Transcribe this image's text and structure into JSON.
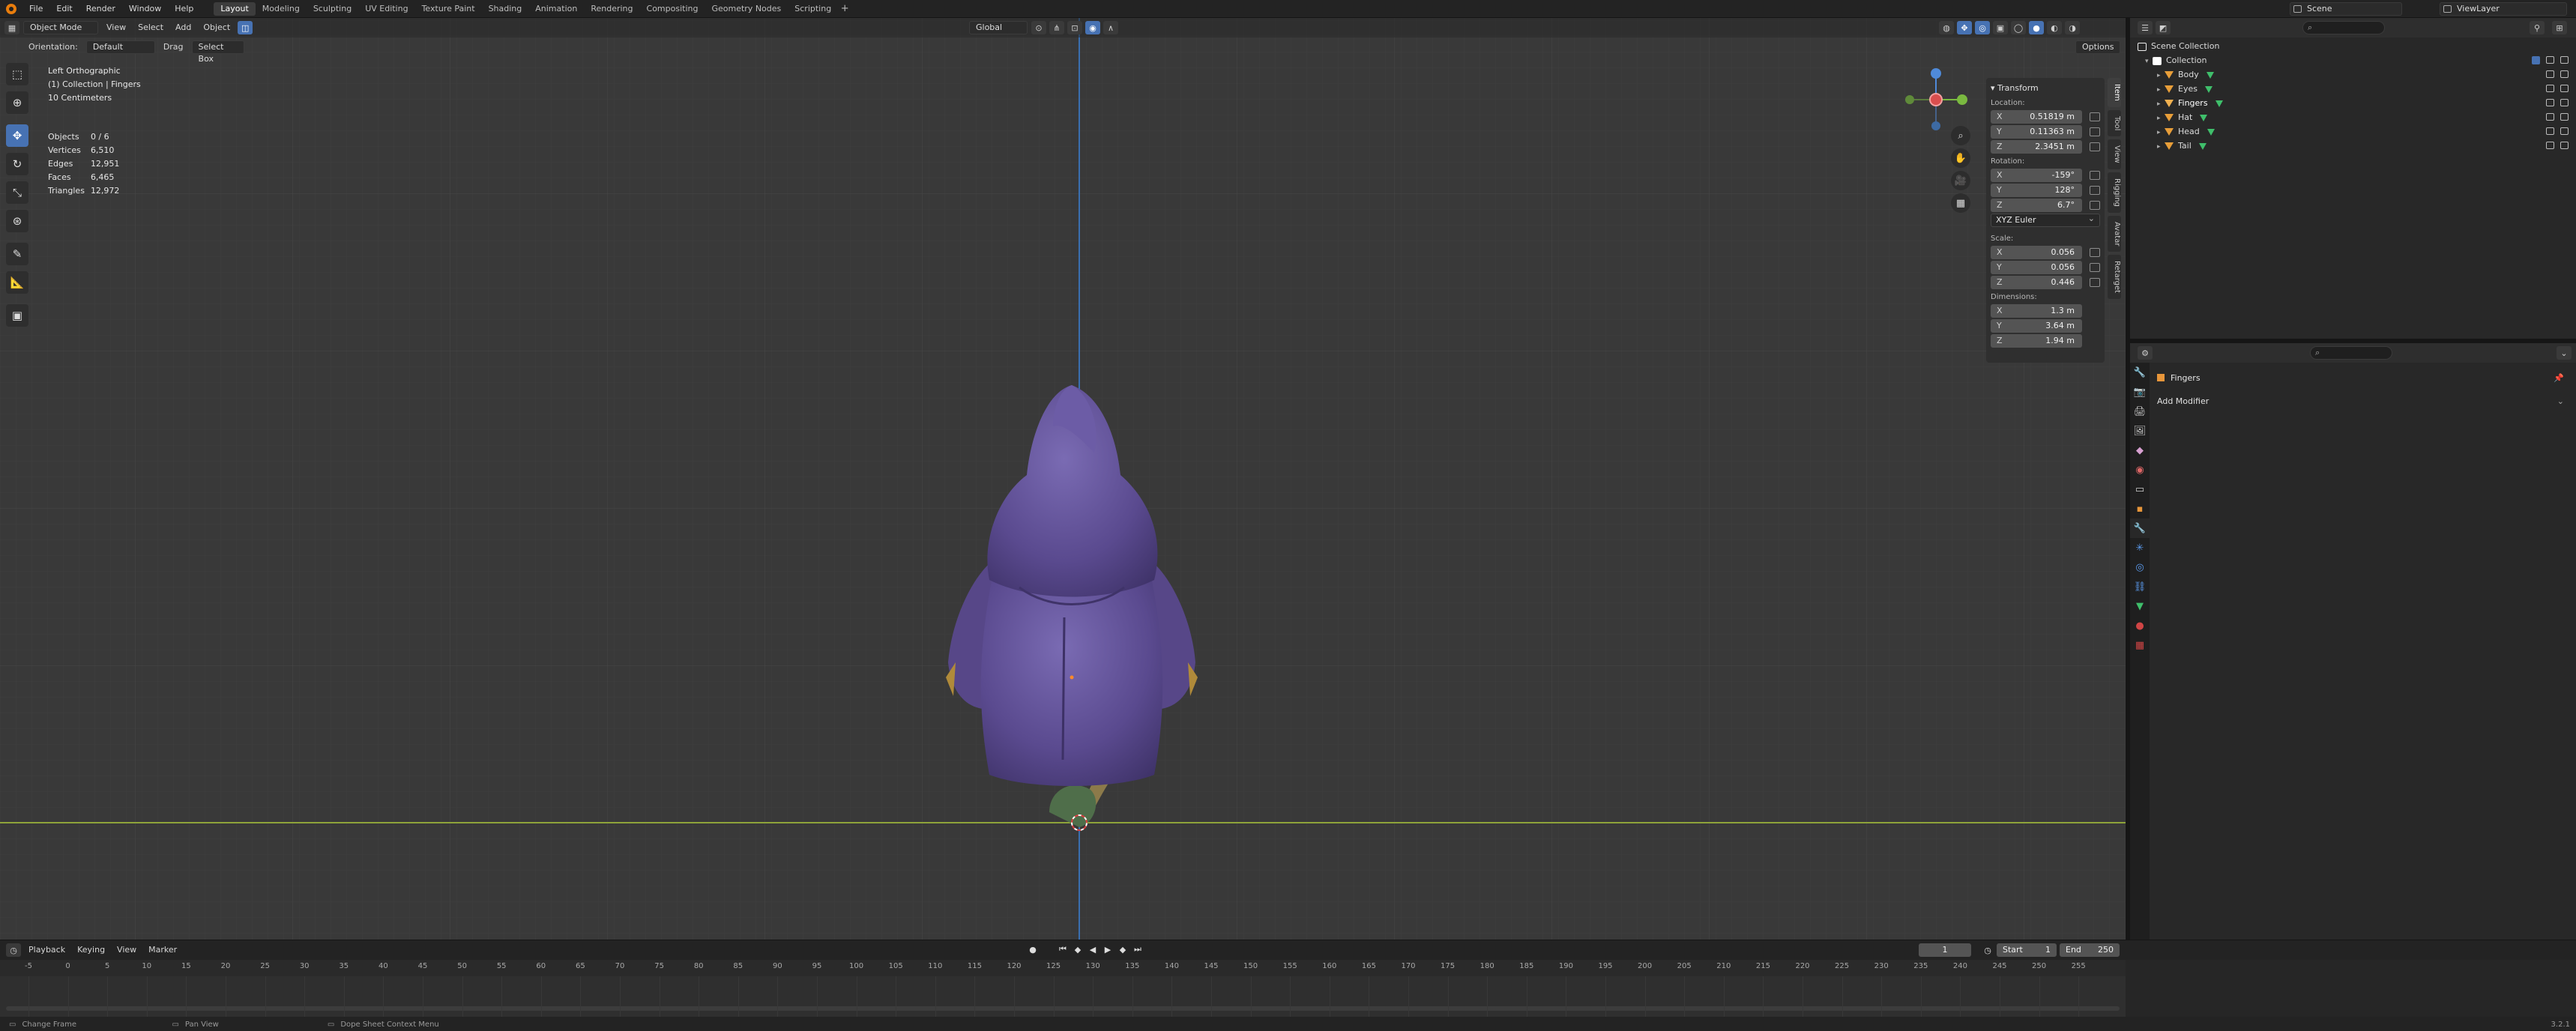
{
  "topbar": {
    "menus": [
      "File",
      "Edit",
      "Render",
      "Window",
      "Help"
    ],
    "workspaces": [
      "Layout",
      "Modeling",
      "Sculpting",
      "UV Editing",
      "Texture Paint",
      "Shading",
      "Animation",
      "Rendering",
      "Compositing",
      "Geometry Nodes",
      "Scripting"
    ],
    "active_workspace": "Layout",
    "scene": "Scene",
    "view_layer": "ViewLayer"
  },
  "viewport": {
    "mode": "Object Mode",
    "menus": [
      "View",
      "Select",
      "Add",
      "Object"
    ],
    "transform_orientation": "Global",
    "orientation_label": "Orientation:",
    "orientation_value": "Default",
    "drag_label": "Drag",
    "drag_value": "Select Box",
    "options": "Options",
    "view_name": "Left Orthographic",
    "collection_info": "(1) Collection | Fingers",
    "scale_info": "10 Centimeters",
    "stats": [
      {
        "label": "Objects",
        "value": "0 / 6"
      },
      {
        "label": "Vertices",
        "value": "6,510"
      },
      {
        "label": "Edges",
        "value": "12,951"
      },
      {
        "label": "Faces",
        "value": "6,465"
      },
      {
        "label": "Triangles",
        "value": "12,972"
      }
    ]
  },
  "npanel": {
    "title": "Transform",
    "location_label": "Location:",
    "location": {
      "x": "0.51819 m",
      "y": "0.11363 m",
      "z": "2.3451 m"
    },
    "rotation_label": "Rotation:",
    "rotation": {
      "x": "-159°",
      "y": "128°",
      "z": "6.7°"
    },
    "rotation_mode": "XYZ Euler",
    "scale_label": "Scale:",
    "scale": {
      "x": "0.056",
      "y": "0.056",
      "z": "0.446"
    },
    "dimensions_label": "Dimensions:",
    "dimensions": {
      "x": "1.3 m",
      "y": "3.64 m",
      "z": "1.94 m"
    },
    "tabs": [
      "Item",
      "Tool",
      "View",
      "Rigging",
      "Avatar",
      "Retarget"
    ]
  },
  "outliner": {
    "root": "Scene Collection",
    "collection": "Collection",
    "objects": [
      "Body",
      "Eyes",
      "Fingers",
      "Hat",
      "Head",
      "Tail"
    ]
  },
  "properties": {
    "object_name": "Fingers",
    "add_modifier": "Add Modifier"
  },
  "timeline": {
    "menus": [
      "Playback",
      "Keying",
      "View",
      "Marker"
    ],
    "current_frame": "1",
    "start_label": "Start",
    "start": "1",
    "end_label": "End",
    "end": "250",
    "ruler": [
      "-5",
      "0",
      "5",
      "10",
      "15",
      "20",
      "25",
      "30",
      "35",
      "40",
      "45",
      "50",
      "55",
      "60",
      "65",
      "70",
      "75",
      "80",
      "85",
      "90",
      "95",
      "100",
      "105",
      "110",
      "115",
      "120",
      "125",
      "130",
      "135",
      "140",
      "145",
      "150",
      "155",
      "160",
      "165",
      "170",
      "175",
      "180",
      "185",
      "190",
      "195",
      "200",
      "205",
      "210",
      "215",
      "220",
      "225",
      "230",
      "235",
      "240",
      "245",
      "250",
      "255"
    ],
    "playhead": "1"
  },
  "statusbar": {
    "items": [
      "Change Frame",
      "Pan View",
      "Dope Sheet Context Menu"
    ],
    "version": "3.2.1"
  },
  "colors": {
    "accent": "#4772b3",
    "x_axis": "#d94e4e",
    "y_axis": "#7ab940",
    "z_axis": "#4f8ad9",
    "hood": "#5e4e94"
  }
}
